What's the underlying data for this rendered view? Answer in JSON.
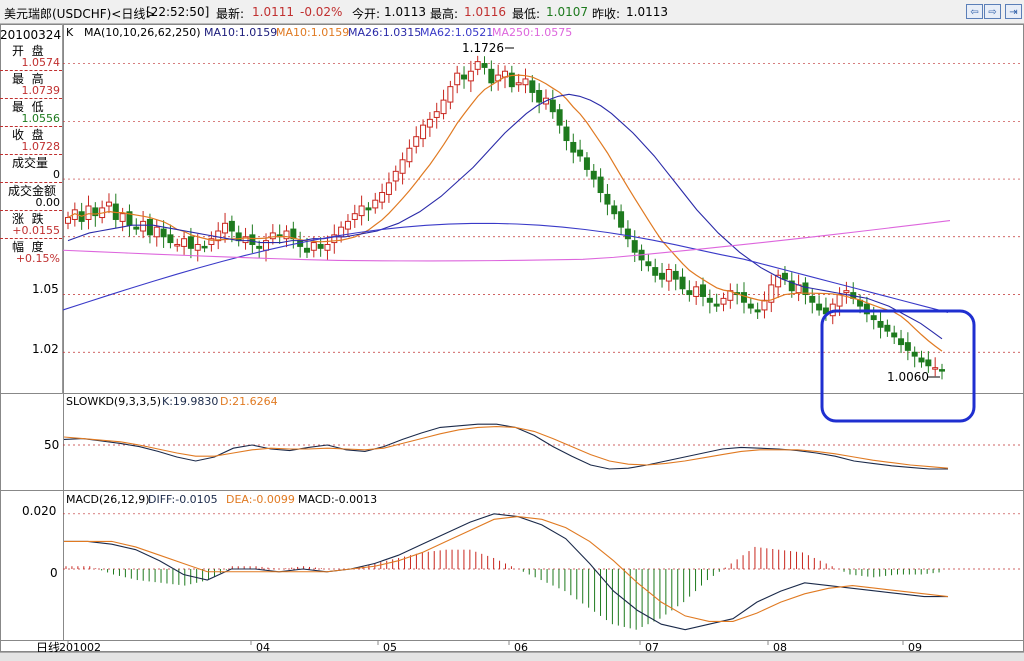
{
  "header": {
    "title": "美元瑞郎(USDCHF)<日线>",
    "time": "[22:52:50]",
    "latest_label": "最新:",
    "latest": "1.0111",
    "change": "-0.02%",
    "open_label": "今开:",
    "open": "1.0113",
    "high_label": "最高:",
    "high": "1.0116",
    "low_label": "最低:",
    "low": "1.0107",
    "prev_label": "昨收:",
    "prev": "1.0113",
    "nav_icons": [
      "back-arrow-icon",
      "forward-arrow-icon",
      "next-arrow-icon"
    ]
  },
  "info_panel": {
    "date": "20100324",
    "open_label": "开  盘",
    "open": "1.0574",
    "high_label": "最  高",
    "high": "1.0739",
    "low_label": "最  低",
    "low": "1.0556",
    "close_label": "收  盘",
    "close": "1.0728",
    "volume_label": "成交量",
    "volume": "0",
    "amount_label": "成交金额",
    "amount": "0.00",
    "change_label": "涨  跌",
    "change": "+0.0155",
    "range_label": "幅  度",
    "range": "+0.15%"
  },
  "legends": {
    "price": {
      "k": "K",
      "ma": "MA(10,10,26,62,250)",
      "ma10a": "MA10:1.0159",
      "ma10b": "MA10:1.0159",
      "ma26": "MA26:1.0315",
      "ma62": "MA62:1.0521",
      "ma250": "MA250:1.0575"
    },
    "kd": {
      "name": "SLOWKD(9,3,3,5)",
      "k": "K:19.9830",
      "d": "D:21.6264"
    },
    "macd": {
      "name": "MACD(26,12,9)",
      "diff": "DIFF:-0.0105",
      "dea": "DEA:-0.0099",
      "macd": "MACD:-0.0013"
    }
  },
  "bottom_label": "日线",
  "colors": {
    "up": "#c8261e",
    "down": "#1e7a1e",
    "ma10": "#e07a22",
    "ma26": "#2a2aa8",
    "ma62": "#3a3ac8",
    "ma250": "#dd66dd",
    "kd_k": "#1b2a4a",
    "kd_d": "#e07a22",
    "annotation_box": "#1f2fd0"
  },
  "chart_data": {
    "type": "candlestick",
    "price_axis_ticks": [
      "1.05",
      "1.02"
    ],
    "kd_axis_ticks": [
      "50"
    ],
    "macd_axis_ticks": [
      "0.020",
      "0"
    ],
    "x_ticks": [
      "201002",
      "04",
      "05",
      "06",
      "07",
      "08",
      "09"
    ],
    "annotations": {
      "max_label": "1.1726",
      "min_label": "1.0060"
    },
    "candles_close": [
      1.09,
      1.094,
      1.088,
      1.096,
      1.091,
      1.095,
      1.098,
      1.089,
      1.092,
      1.086,
      1.084,
      1.088,
      1.081,
      1.085,
      1.08,
      1.077,
      1.076,
      1.079,
      1.074,
      1.076,
      1.075,
      1.079,
      1.083,
      1.087,
      1.083,
      1.078,
      1.08,
      1.076,
      1.074,
      1.078,
      1.082,
      1.08,
      1.083,
      1.079,
      1.075,
      1.072,
      1.077,
      1.074,
      1.076,
      1.081,
      1.085,
      1.088,
      1.092,
      1.096,
      1.094,
      1.099,
      1.103,
      1.108,
      1.114,
      1.12,
      1.126,
      1.132,
      1.138,
      1.141,
      1.145,
      1.151,
      1.158,
      1.165,
      1.162,
      1.166,
      1.171,
      1.168,
      1.16,
      1.164,
      1.166,
      1.158,
      1.16,
      1.162,
      1.155,
      1.15,
      1.152,
      1.145,
      1.138,
      1.13,
      1.124,
      1.122,
      1.115,
      1.11,
      1.103,
      1.097,
      1.092,
      1.085,
      1.079,
      1.072,
      1.068,
      1.065,
      1.06,
      1.058,
      1.063,
      1.058,
      1.053,
      1.05,
      1.054,
      1.049,
      1.046,
      1.044,
      1.048,
      1.052,
      1.05,
      1.046,
      1.043,
      1.041,
      1.047,
      1.055,
      1.06,
      1.058,
      1.052,
      1.055,
      1.05,
      1.046,
      1.042,
      1.04,
      1.045,
      1.05,
      1.052,
      1.048,
      1.044,
      1.04,
      1.037,
      1.033,
      1.031,
      1.028,
      1.024,
      1.021,
      1.018,
      1.015,
      1.013,
      1.012,
      1.011
    ],
    "ma26_values": [
      1.078,
      1.08,
      1.082,
      1.083,
      1.084,
      1.085,
      1.086,
      1.086,
      1.086,
      1.085,
      1.084,
      1.083,
      1.082,
      1.081,
      1.08,
      1.079,
      1.078,
      1.078,
      1.077,
      1.077,
      1.077,
      1.078,
      1.078,
      1.079,
      1.079,
      1.08,
      1.08,
      1.081,
      1.082,
      1.083,
      1.085,
      1.087,
      1.09,
      1.093,
      1.097,
      1.101,
      1.106,
      1.111,
      1.116,
      1.122,
      1.128,
      1.134,
      1.139,
      1.144,
      1.148,
      1.151,
      1.153,
      1.154,
      1.153,
      1.151,
      1.148,
      1.144,
      1.139,
      1.134,
      1.128,
      1.122,
      1.115,
      1.108,
      1.101,
      1.094,
      1.088,
      1.082,
      1.077,
      1.072,
      1.068,
      1.064,
      1.061,
      1.058,
      1.056,
      1.054,
      1.053,
      1.052,
      1.051,
      1.05,
      1.049,
      1.048,
      1.046,
      1.044,
      1.041,
      1.038,
      1.035,
      1.031,
      1.027
    ],
    "kd_k": [
      57,
      58,
      55,
      52,
      48,
      42,
      35,
      30,
      35,
      46,
      50,
      45,
      43,
      47,
      50,
      44,
      42,
      48,
      57,
      65,
      72,
      74,
      76,
      76,
      72,
      62,
      48,
      36,
      25,
      20,
      21,
      25,
      30,
      35,
      40,
      45,
      47,
      46,
      45,
      43,
      40,
      36,
      30,
      27,
      24,
      22,
      20,
      20
    ],
    "kd_d": [
      60,
      58,
      56,
      54,
      50,
      45,
      40,
      36,
      36,
      40,
      44,
      46,
      45,
      45,
      46,
      45,
      44,
      46,
      52,
      58,
      64,
      69,
      72,
      73,
      72,
      67,
      58,
      48,
      38,
      30,
      26,
      25,
      27,
      30,
      34,
      38,
      42,
      44,
      44,
      44,
      42,
      39,
      35,
      31,
      28,
      25,
      23,
      21
    ],
    "macd_diff": [
      0.01,
      0.01,
      0.009,
      0.007,
      0.003,
      -0.002,
      -0.004,
      0.0,
      0.0,
      -0.001,
      0.0,
      -0.001,
      0.0,
      0.002,
      0.005,
      0.009,
      0.013,
      0.017,
      0.02,
      0.019,
      0.016,
      0.011,
      0.002,
      -0.008,
      -0.015,
      -0.02,
      -0.022,
      -0.02,
      -0.018,
      -0.012,
      -0.008,
      -0.005,
      -0.006,
      -0.007,
      -0.008,
      -0.009,
      -0.01,
      -0.01
    ],
    "macd_dea": [
      0.01,
      0.01,
      0.01,
      0.008,
      0.005,
      0.002,
      -0.001,
      -0.001,
      -0.001,
      -0.001,
      -0.001,
      -0.001,
      0.0,
      0.001,
      0.003,
      0.006,
      0.01,
      0.014,
      0.018,
      0.019,
      0.018,
      0.015,
      0.01,
      0.003,
      -0.005,
      -0.012,
      -0.017,
      -0.019,
      -0.019,
      -0.016,
      -0.012,
      -0.009,
      -0.007,
      -0.006,
      -0.007,
      -0.008,
      -0.009,
      -0.01
    ],
    "macd_hist": [
      0.001,
      0.001,
      -0.002,
      -0.004,
      -0.005,
      -0.006,
      -0.004,
      0.001,
      0.001,
      0.0,
      0.001,
      0.0,
      0.0,
      0.002,
      0.004,
      0.006,
      0.007,
      0.007,
      0.004,
      0.0,
      -0.004,
      -0.008,
      -0.014,
      -0.02,
      -0.022,
      -0.018,
      -0.012,
      -0.004,
      0.002,
      0.008,
      0.007,
      0.006,
      0.002,
      -0.002,
      -0.003,
      -0.002,
      -0.002,
      -0.001
    ]
  }
}
